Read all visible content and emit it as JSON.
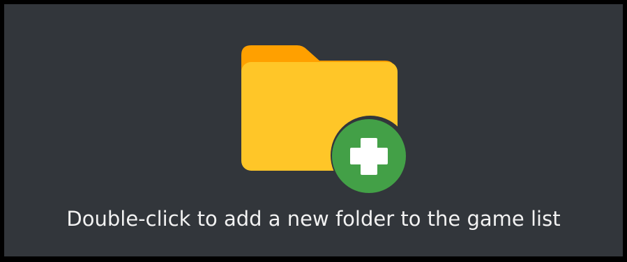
{
  "add_folder_area": {
    "hint_text": "Double-click to add a new folder to the game list",
    "icon": "folder-add-icon",
    "colors": {
      "background": "#32363b",
      "border": "#000000",
      "folder_back": "#ffa000",
      "folder_front": "#ffc628",
      "plus_badge": "#43a047",
      "plus_sign": "#ffffff",
      "text": "#f2f2f2"
    }
  }
}
